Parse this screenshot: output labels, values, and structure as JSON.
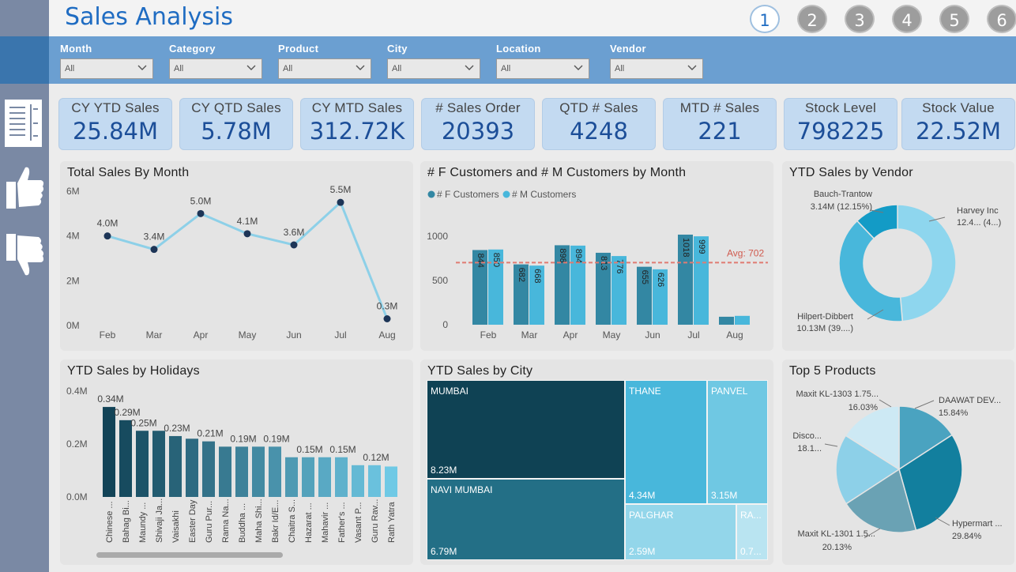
{
  "header": {
    "title": "Sales Analysis",
    "pages": [
      "1",
      "2",
      "3",
      "4",
      "5",
      "6"
    ]
  },
  "filters": [
    {
      "label": "Month",
      "value": "All"
    },
    {
      "label": "Category",
      "value": "All"
    },
    {
      "label": "Product",
      "value": "All"
    },
    {
      "label": "City",
      "value": "All"
    },
    {
      "label": "Location",
      "value": "All"
    },
    {
      "label": "Vendor",
      "value": "All"
    }
  ],
  "kpis": [
    {
      "label": "CY YTD Sales",
      "value": "25.84M"
    },
    {
      "label": "CY QTD Sales",
      "value": "5.78M"
    },
    {
      "label": "CY MTD Sales",
      "value": "312.72K"
    },
    {
      "label": "# Sales Order",
      "value": "20393"
    },
    {
      "label": "QTD # Sales",
      "value": "4248"
    },
    {
      "label": "MTD # Sales",
      "value": "221"
    },
    {
      "label": "Stock Level",
      "value": "798225"
    },
    {
      "label": "Stock Value",
      "value": "22.52M"
    }
  ],
  "colors": {
    "accent": "#1f6cc2",
    "filterbar": "#6b9fd1",
    "kpi_bg": "#c3daf1",
    "line": "#8dd0e8",
    "dot": "#1d3557",
    "f_bar": "#3387a3",
    "m_bar": "#48b7db",
    "avg": "#e07b72"
  },
  "chart_data": [
    {
      "type": "line",
      "title": "Total Sales By Month",
      "categories": [
        "Feb",
        "Mar",
        "Apr",
        "May",
        "Jun",
        "Jul",
        "Aug"
      ],
      "values": [
        4.0,
        3.4,
        5.0,
        4.1,
        3.6,
        5.5,
        0.3
      ],
      "labels": [
        "4.0M",
        "3.4M",
        "5.0M",
        "4.1M",
        "3.6M",
        "5.5M",
        "0.3M"
      ],
      "yticks": [
        "0M",
        "2M",
        "4M",
        "6M"
      ],
      "ylim": [
        0,
        6
      ]
    },
    {
      "type": "bar",
      "title": "# F Customers and # M Customers by Month",
      "categories": [
        "Feb",
        "Mar",
        "Apr",
        "May",
        "Jun",
        "Jul",
        "Aug"
      ],
      "series": [
        {
          "name": "# F Customers",
          "values": [
            844,
            682,
            898,
            813,
            655,
            1018,
            90
          ]
        },
        {
          "name": "# M Customers",
          "values": [
            850,
            668,
            894,
            776,
            626,
            999,
            100
          ]
        }
      ],
      "labels_shown": [
        true,
        true,
        true,
        true,
        true,
        true,
        false
      ],
      "avg_label": "Avg: 702",
      "avg": 702,
      "yticks": [
        "0",
        "500",
        "1000"
      ],
      "ylim": [
        0,
        1200
      ]
    },
    {
      "type": "pie",
      "title": "YTD Sales by Vendor",
      "slices": [
        {
          "label": "Harvey Inc",
          "value_label": "12.4... (4...)",
          "value": 12.57,
          "color": "#8ed6ee"
        },
        {
          "label": "Hilpert-Dibbert",
          "value_label": "10.13M (39....)",
          "value": 10.13,
          "color": "#48b7db"
        },
        {
          "label": "Bauch-Trantow",
          "value_label": "3.14M (12.15%)",
          "value": 3.14,
          "color": "#139bc6"
        }
      ]
    },
    {
      "type": "bar",
      "title": "YTD Sales by Holidays",
      "categories": [
        "Chinese ...",
        "Bahag Bi...",
        "Maundy ...",
        "Shivaji Ja...",
        "Vaisakhi",
        "Easter Day",
        "Guru Pur...",
        "Rama Na...",
        "Buddha ...",
        "Maha Shi...",
        "Bakr Id/E...",
        "Chaitra S...",
        "Hazarat ...",
        "Mahavir ...",
        "Father's ...",
        "Vasant P...",
        "Guru Rav...",
        "Rath Yatra"
      ],
      "values": [
        0.34,
        0.29,
        0.25,
        0.25,
        0.23,
        0.22,
        0.21,
        0.19,
        0.19,
        0.19,
        0.19,
        0.15,
        0.15,
        0.15,
        0.15,
        0.12,
        0.12,
        0.115
      ],
      "labels": [
        "0.34M",
        "0.29M",
        "0.25M",
        "",
        "0.23M",
        "",
        "0.21M",
        "",
        "0.19M",
        "",
        "0.19M",
        "",
        "0.15M",
        "",
        "0.15M",
        "",
        "0.12M",
        ""
      ],
      "yticks": [
        "0.0M",
        "0.2M",
        "0.4M"
      ],
      "ylim": [
        0,
        0.4
      ]
    },
    {
      "type": "treemap",
      "title": "YTD Sales by City",
      "items": [
        {
          "name": "MUMBAI",
          "value_label": "8.23M"
        },
        {
          "name": "NAVI MUMBAI",
          "value_label": "6.79M"
        },
        {
          "name": "THANE",
          "value_label": "4.34M"
        },
        {
          "name": "PANVEL",
          "value_label": "3.15M"
        },
        {
          "name": "PALGHAR",
          "value_label": "2.59M"
        },
        {
          "name": "RA...",
          "value_label": "0.7..."
        }
      ]
    },
    {
      "type": "pie",
      "title": "Top 5 Products",
      "slices": [
        {
          "label": "DAAWAT DEV...",
          "pct": "15.84%",
          "value": 15.84,
          "color": "#4aa3c0"
        },
        {
          "label": "Hypermart ...",
          "pct": "29.84%",
          "value": 29.84,
          "color": "#127f9e"
        },
        {
          "label": "Maxit KL-1301 1.5...",
          "pct": "20.13%",
          "value": 20.13,
          "color": "#6aa2b4"
        },
        {
          "label": "Disco...",
          "pct": "18.1...",
          "value": 18.16,
          "color": "#8dd0e8"
        },
        {
          "label": "Maxit KL-1303 1.75...",
          "pct": "16.03%",
          "value": 16.03,
          "color": "#cde9f4"
        }
      ]
    }
  ]
}
